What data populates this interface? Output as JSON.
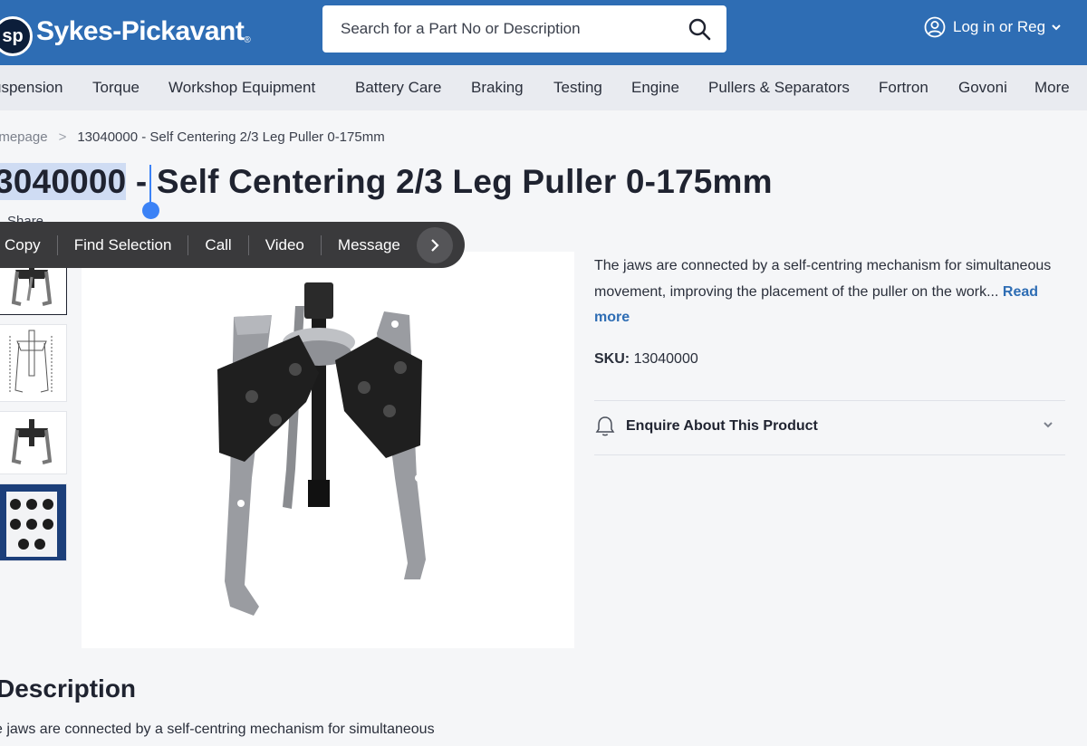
{
  "header": {
    "logo_badge": "sp",
    "logo_text": "Sykes-Pickavant",
    "logo_reg": "®",
    "search_placeholder": "Search for a Part No or Description",
    "login_label": "Log in or Reg"
  },
  "nav": {
    "items": [
      "uspension",
      "Torque",
      "Workshop Equipment",
      "Battery Care",
      "Braking",
      "Testing",
      "Engine",
      "Pullers & Separators",
      "Fortron",
      "Govoni",
      "More"
    ]
  },
  "breadcrumb": {
    "home": "omepage",
    "separator": ">",
    "current": "13040000 - Self Centering 2/3 Leg Puller 0-175mm"
  },
  "product": {
    "title_selected": "3040000",
    "title_rest": " - Self Centering 2/3 Leg Puller 0-175mm",
    "share": "Share",
    "short_description": "The jaws are connected by a self-centring mechanism for simultaneous movement, improving the placement of the puller on the work...",
    "read_more": "Read more",
    "sku_label": "SKU:",
    "sku_value": "13040000",
    "enquire_label": "Enquire About This Product",
    "description_heading": "Description",
    "description_body": "e jaws are connected by a self-centring mechanism for simultaneous"
  },
  "context_menu": {
    "items": [
      "Copy",
      "Find Selection",
      "Call",
      "Video",
      "Message"
    ]
  },
  "colors": {
    "header_bg": "#2e6db4",
    "nav_bg": "#e9ebf0",
    "page_bg": "#f5f6f8",
    "accent_link": "#2e6db4",
    "selection": "#cfdcf3",
    "caret": "#3b82f6",
    "context_menu_bg": "#3a3a3c"
  },
  "icons": {
    "search": "search-icon",
    "user": "user-circle-icon",
    "chevron": "chevron-down-icon",
    "bell": "bell-icon",
    "next": "chevron-right-icon"
  }
}
